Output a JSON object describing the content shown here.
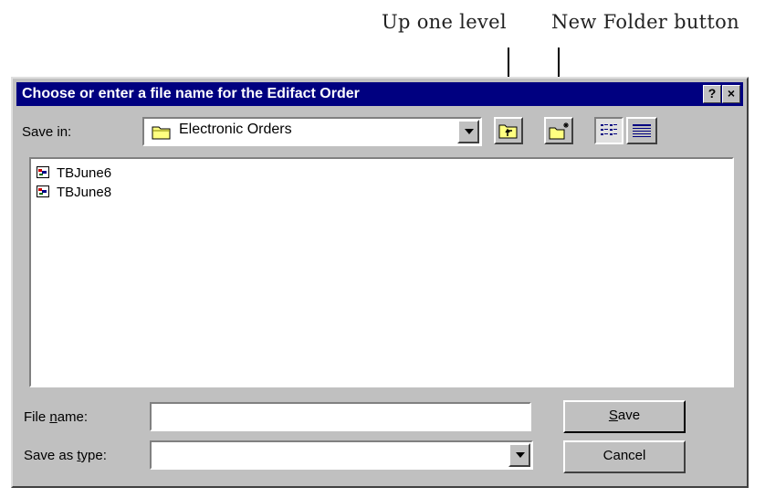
{
  "annotations": {
    "up_one_level": "Up one level",
    "new_folder": "New Folder button"
  },
  "dialog": {
    "title": "Choose or enter a file name for the Edifact Order",
    "title_buttons": {
      "help": "?",
      "close": "×"
    },
    "save_in": {
      "label": "Save in:",
      "value": "Electronic Orders",
      "icon": "folder-icon"
    },
    "toolbar_icons": [
      "up-one-level-icon",
      "new-folder-icon",
      "list-view-icon",
      "details-view-icon"
    ],
    "files": [
      {
        "name": "TBJune6",
        "icon": "edifact-file-icon"
      },
      {
        "name": "TBJune8",
        "icon": "edifact-file-icon"
      }
    ],
    "file_name": {
      "label_pre": "File ",
      "label_key": "n",
      "label_post": "ame:",
      "value": ""
    },
    "save_as_type": {
      "label_pre": "Save as ",
      "label_key": "t",
      "label_post": "ype:",
      "value": ""
    },
    "buttons": {
      "save_key": "S",
      "save_rest": "ave",
      "cancel": "Cancel"
    }
  },
  "colors": {
    "titlebar": "#000080",
    "face": "#c0c0c0"
  }
}
